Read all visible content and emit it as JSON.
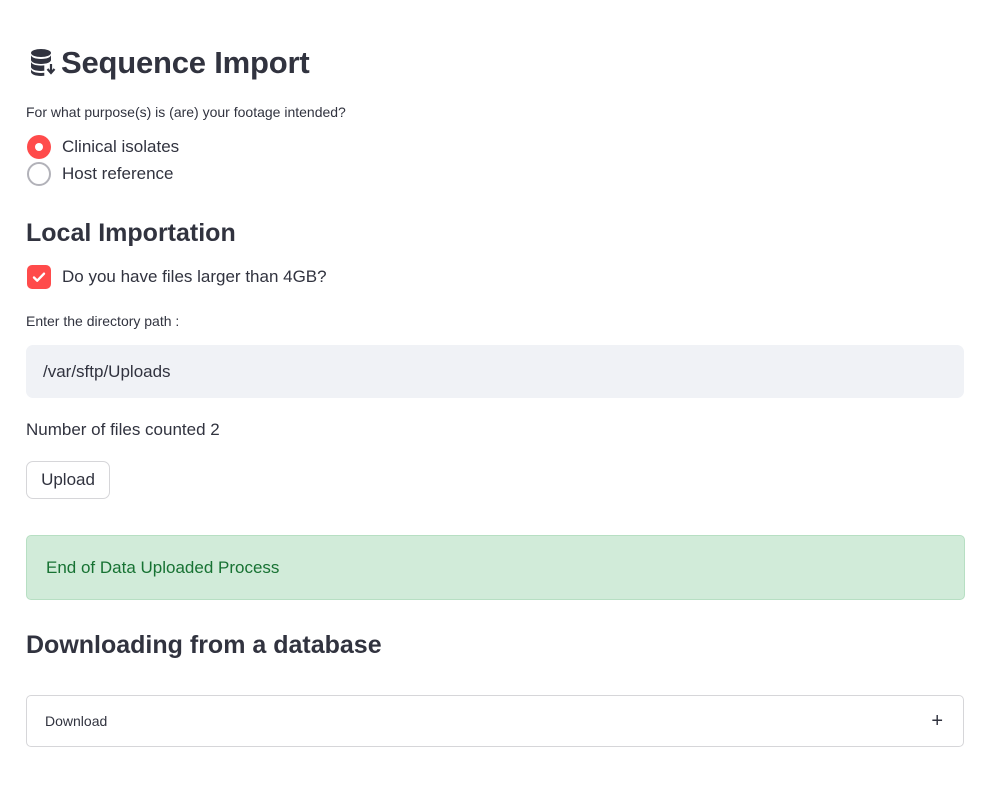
{
  "header": {
    "title": "Sequence Import",
    "icon": "database-download-icon"
  },
  "purpose": {
    "question": "For what purpose(s) is (are) your footage intended?",
    "options": [
      "Clinical isolates",
      "Host reference"
    ],
    "selected": "Clinical isolates"
  },
  "local": {
    "heading": "Local Importation",
    "large_files_label": "Do you have files larger than 4GB?",
    "large_files_checked": true,
    "path_label": "Enter the directory path :",
    "path_value": "/var/sftp/Uploads",
    "count_text": "Number of files counted 2",
    "upload_label": "Upload",
    "success_message": "End of Data Uploaded Process"
  },
  "database": {
    "heading": "Downloading from a database",
    "expander_label": "Download",
    "expander_icon": "plus-icon"
  },
  "colors": {
    "accent": "#ff4b4b",
    "text": "#31333f",
    "input_bg": "#f0f2f6",
    "success_bg": "#d1ebd9",
    "success_text": "#177233"
  }
}
